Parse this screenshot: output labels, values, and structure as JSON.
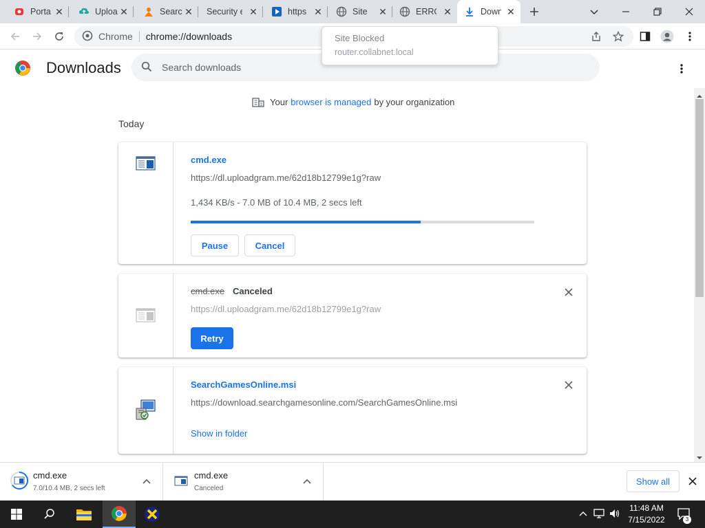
{
  "browser": {
    "tabs": [
      {
        "title": "Porta",
        "icon": "youtube-like-red-icon"
      },
      {
        "title": "Uploa",
        "icon": "upload-cloud-icon"
      },
      {
        "title": "Searc",
        "icon": "person-orange-icon"
      },
      {
        "title": "Security e",
        "icon": "none"
      },
      {
        "title": "https",
        "icon": "play-blue-icon"
      },
      {
        "title": "Site B",
        "icon": "globe-icon"
      },
      {
        "title": "ERRO",
        "icon": "globe-icon"
      },
      {
        "title": "Down",
        "icon": "download-icon"
      }
    ],
    "omnibox": {
      "chip": "Chrome",
      "url": "chrome://downloads"
    },
    "popup": {
      "title": "Site Blocked",
      "host": "router.collabnet.local"
    }
  },
  "page": {
    "title": "Downloads",
    "search_placeholder": "Search downloads",
    "managed": {
      "before": "Your",
      "link": "browser is managed",
      "after": "by your organization"
    },
    "section": "Today",
    "items": [
      {
        "name": "cmd.exe",
        "url": "https://dl.uploadgram.me/62d18b12799e1g?raw",
        "status": "1,434 KB/s - 7.0 MB of 10.4 MB, 2 secs left",
        "progress": 0.67,
        "buttons": [
          "Pause",
          "Cancel"
        ]
      },
      {
        "name": "cmd.exe",
        "state": "Canceled",
        "url": "https://dl.uploadgram.me/62d18b12799e1g?raw",
        "buttons": [
          "Retry"
        ]
      },
      {
        "name": "SearchGamesOnline.msi",
        "url": "https://download.searchgamesonline.com/SearchGamesOnline.msi",
        "link": "Show in folder"
      }
    ]
  },
  "shelf": {
    "items": [
      {
        "name": "cmd.exe",
        "status": "7.0/10.4 MB, 2 secs left"
      },
      {
        "name": "cmd.exe",
        "status": "Canceled"
      }
    ],
    "show_all": "Show all"
  },
  "taskbar": {
    "time": "11:48 AM",
    "date": "7/15/2022",
    "notifications": "3"
  },
  "colors": {
    "accent": "#1a73e8",
    "tabstrip": "#dee1e6",
    "taskbar": "#1f1f1f"
  }
}
